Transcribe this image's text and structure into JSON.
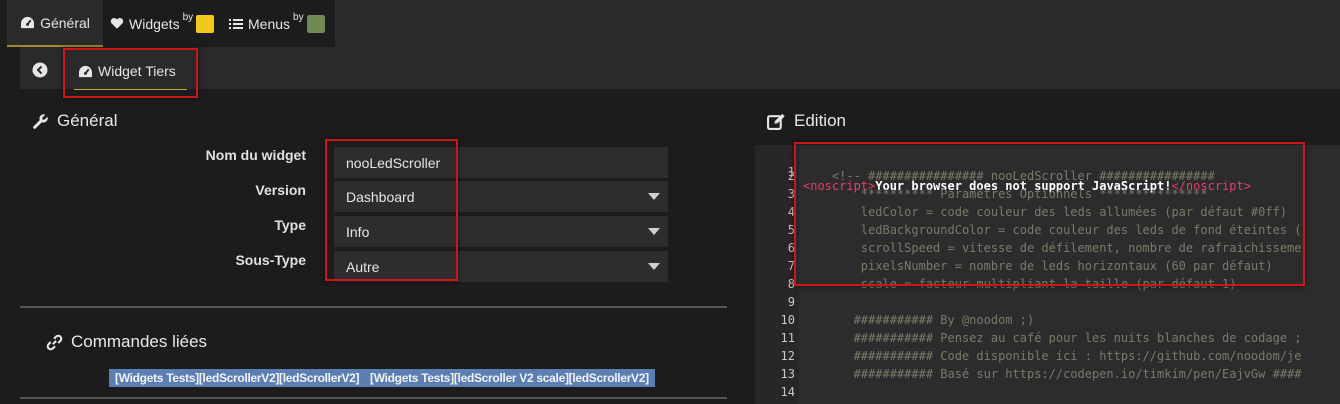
{
  "nav": {
    "tabs": [
      {
        "label": "Général"
      },
      {
        "label": "Widgets",
        "sup": "by"
      },
      {
        "label": "Menus",
        "sup": "by"
      }
    ]
  },
  "subnav": {
    "tab_label": "Widget Tiers"
  },
  "general": {
    "title": "Général",
    "fields": [
      {
        "label": "Nom du widget",
        "value": "nooLedScroller"
      },
      {
        "label": "Version",
        "value": "Dashboard"
      },
      {
        "label": "Type",
        "value": "Info"
      },
      {
        "label": "Sous-Type",
        "value": "Autre"
      }
    ]
  },
  "commands": {
    "title": "Commandes liées",
    "chips": [
      "[Widgets Tests][ledScrollerV2][ledScrollerV2]",
      "[Widgets Tests][ledScroller V2 scale][ledScrollerV2]"
    ]
  },
  "edition": {
    "title": "Edition",
    "lines": [
      {
        "n": "1",
        "open": "<noscript>",
        "text": "Your browser does not support JavaScript!",
        "close": "</noscript>"
      },
      {
        "n": "2",
        "code": "    <!-- ################ nooLedScroller ################"
      },
      {
        "n": "3",
        "code": "        ********** Paramètres Optionnels ***************"
      },
      {
        "n": "4",
        "code": "        ledColor = code couleur des leds allumées (par défaut #0ff)"
      },
      {
        "n": "5",
        "code": "        ledBackgroundColor = code couleur des leds de fond éteintes ("
      },
      {
        "n": "6",
        "code": "        scrollSpeed = vitesse de défilement, nombre de rafraichisseme"
      },
      {
        "n": "7",
        "code": "        pixelsNumber = nombre de leds horizontaux (60 par défaut)"
      },
      {
        "n": "8",
        "code": "        scale = facteur multipliant la taille (par défaut 1)"
      },
      {
        "n": "9",
        "code": ""
      },
      {
        "n": "10",
        "code": "       ########### By @noodom ;)"
      },
      {
        "n": "11",
        "code": "       ########### Pensez au café pour les nuits blanches de codage ;"
      },
      {
        "n": "12",
        "code": "       ########### Code disponible ici : https://github.com/noodom/je"
      },
      {
        "n": "13",
        "code": "       ########### Basé sur https://codepen.io/timkim/pen/EajvGw ####"
      },
      {
        "n": "14",
        "code": ""
      }
    ]
  },
  "colors": {
    "accent_underline": "#c9a938",
    "highlight_box": "#d0151a",
    "chip_bg": "#5b7fb3",
    "tag_color": "#e83c6c"
  },
  "icons": [
    "dashboard-icon",
    "heart-icon",
    "list-icon",
    "back-circle-icon",
    "wrench-icon",
    "edit-icon",
    "link-icon"
  ]
}
